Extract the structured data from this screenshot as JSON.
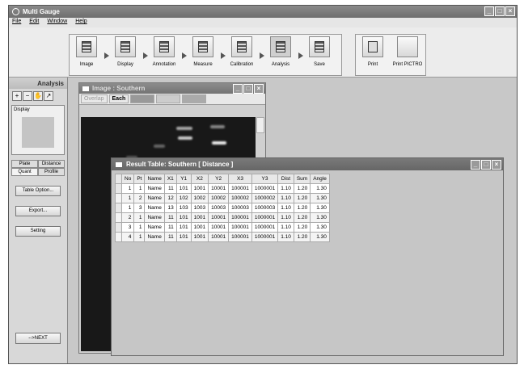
{
  "app": {
    "title": "Multi Gauge",
    "window_buttons": [
      "_",
      "□",
      "×"
    ]
  },
  "menu": [
    "File",
    "Edit",
    "Window",
    "Help"
  ],
  "toolbar": {
    "steps": [
      "Image",
      "Display",
      "Annotation",
      "Measure",
      "Calibration",
      "Analysis",
      "Save"
    ],
    "print": "Print",
    "print_pictro": "Print PICTRO"
  },
  "sidebar": {
    "title": "Analysis",
    "display_label": "Display",
    "tabs": [
      "Plate",
      "Distance",
      "Quant",
      "Profile"
    ],
    "buttons": [
      "Table Option...",
      "Export...",
      "Setting"
    ],
    "next": "-->NEXT"
  },
  "image_window": {
    "title": "Image : Southern",
    "overlap": "Overlap",
    "each": "Each"
  },
  "result_window": {
    "title": "Result Table: Southern [ Distance ]",
    "columns": [
      "No",
      "Pt",
      "Name",
      "X1",
      "Y1",
      "X2",
      "Y2",
      "X3",
      "Y3",
      "Dist",
      "Sum",
      "Angle"
    ],
    "rows": [
      [
        "1",
        "1",
        "Name",
        "11",
        "101",
        "1001",
        "10001",
        "100001",
        "1000001",
        "1.10",
        "1.20",
        "1.30"
      ],
      [
        "1",
        "2",
        "Name",
        "12",
        "102",
        "1002",
        "10002",
        "100002",
        "1000002",
        "1.10",
        "1.20",
        "1.30"
      ],
      [
        "1",
        "3",
        "Name",
        "13",
        "103",
        "1003",
        "10003",
        "100003",
        "1000003",
        "1.10",
        "1.20",
        "1.30"
      ],
      [
        "2",
        "1",
        "Name",
        "11",
        "101",
        "1001",
        "10001",
        "100001",
        "1000001",
        "1.10",
        "1.20",
        "1.30"
      ],
      [
        "3",
        "1",
        "Name",
        "11",
        "101",
        "1001",
        "10001",
        "100001",
        "1000001",
        "1.10",
        "1.20",
        "1.30"
      ],
      [
        "4",
        "1",
        "Name",
        "11",
        "101",
        "1001",
        "10001",
        "100001",
        "1000001",
        "1.10",
        "1.20",
        "1.30"
      ]
    ]
  }
}
